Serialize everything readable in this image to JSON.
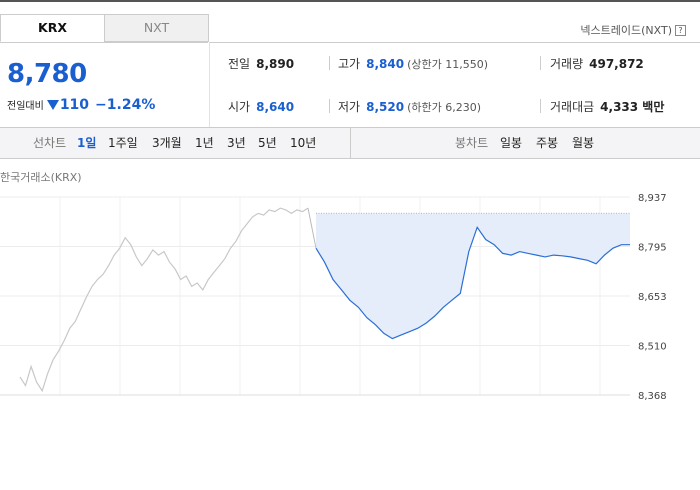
{
  "tabs": {
    "krx_label": "KRX",
    "nxt_label": "NXT"
  },
  "nxt_trade_link": "넥스트레이드(NXT)",
  "help_glyph": "?",
  "price": {
    "current": "8,780",
    "change_label": "전일대비",
    "change_value": "110",
    "change_percent": "−1.24%",
    "direction": "down",
    "color": "#1a5fd0"
  },
  "summary": {
    "prev_close_label": "전일",
    "prev_close": "8,890",
    "high_label": "고가",
    "high": "8,840",
    "upper_limit": "(상한가 11,550)",
    "volume_label": "거래량",
    "volume": "497,872",
    "open_label": "시가",
    "open": "8,640",
    "low_label": "저가",
    "low": "8,520",
    "lower_limit": "(하한가 6,230)",
    "amount_label": "거래대금",
    "amount": "4,333 백만"
  },
  "line_chart_tabs": {
    "label": "선차트",
    "options": [
      "1일",
      "1주일",
      "3개월",
      "1년",
      "3년",
      "5년",
      "10년"
    ],
    "selected": "1일"
  },
  "candle_chart_tabs": {
    "label": "봉차트",
    "options": [
      "일봉",
      "주봉",
      "월봉"
    ]
  },
  "chart_title": "한국거래소(KRX)",
  "chart_data": {
    "type": "line",
    "title": "한국거래소(KRX)",
    "y_ticks": [
      "8,937",
      "8,795",
      "8,653",
      "8,510",
      "8,368"
    ],
    "ylim": [
      8368,
      8937
    ],
    "reference_line": 8890,
    "series": [
      {
        "color": "#c8c8c8",
        "values": [
          8420,
          8395,
          8450,
          8405,
          8380,
          8430,
          8470,
          8495,
          8525,
          8560,
          8580,
          8615,
          8650,
          8680,
          8700,
          8715,
          8740,
          8770,
          8790,
          8820,
          8800,
          8765,
          8740,
          8760,
          8785,
          8770,
          8780,
          8750,
          8730,
          8700,
          8710,
          8680,
          8690,
          8670,
          8700,
          8720,
          8740,
          8760,
          8790,
          8810,
          8840,
          8860,
          8880,
          8890,
          8885,
          8900,
          8895,
          8905,
          8900,
          8890,
          8900,
          8895,
          8905
        ]
      },
      {
        "color": "#2b6fd6",
        "values": [
          8790,
          8750,
          8700,
          8670,
          8640,
          8620,
          8590,
          8570,
          8545,
          8530,
          8540,
          8550,
          8560,
          8575,
          8595,
          8620,
          8640,
          8660,
          8780,
          8850,
          8815,
          8800,
          8775,
          8770,
          8780,
          8775,
          8770,
          8765,
          8770,
          8768,
          8765,
          8760,
          8755,
          8745,
          8770,
          8790,
          8800,
          8800
        ]
      }
    ]
  }
}
